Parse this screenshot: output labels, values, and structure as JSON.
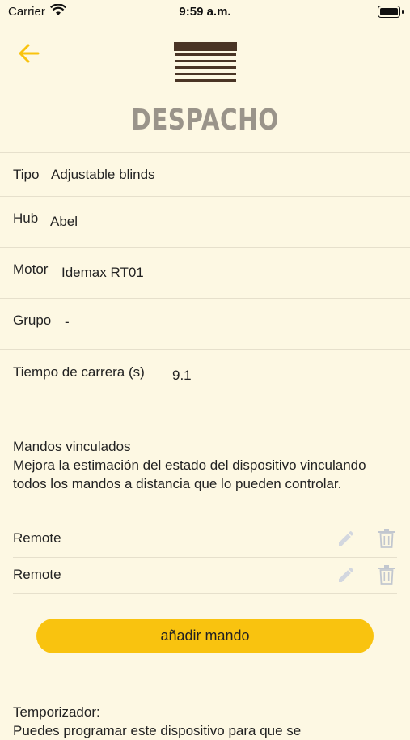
{
  "status_bar": {
    "carrier": "Carrier",
    "time": "9:59 a.m."
  },
  "header": {
    "title": "DESPACHO",
    "back_icon": "arrow-left-icon",
    "accent": "#f9c30f"
  },
  "details": {
    "tipo": {
      "label": "Tipo",
      "value": "Adjustable blinds"
    },
    "hub": {
      "label": "Hub",
      "value": "Abel"
    },
    "motor": {
      "label": "Motor",
      "value": "Idemax RT01"
    },
    "grupo": {
      "label": "Grupo",
      "value": "-"
    },
    "tiempo": {
      "label": "Tiempo de carrera (s)",
      "value": "9.1"
    }
  },
  "remotes": {
    "heading": "Mandos vinculados",
    "description": "Mejora la estimación del estado del dispositivo vinculando todos los mandos a distancia que lo pueden controlar.",
    "items": [
      {
        "name": "Remote"
      },
      {
        "name": "Remote"
      }
    ],
    "add_label": "añadir mando"
  },
  "timer": {
    "heading": "Temporizador:",
    "description": "Puedes programar este dispositivo para que se"
  }
}
